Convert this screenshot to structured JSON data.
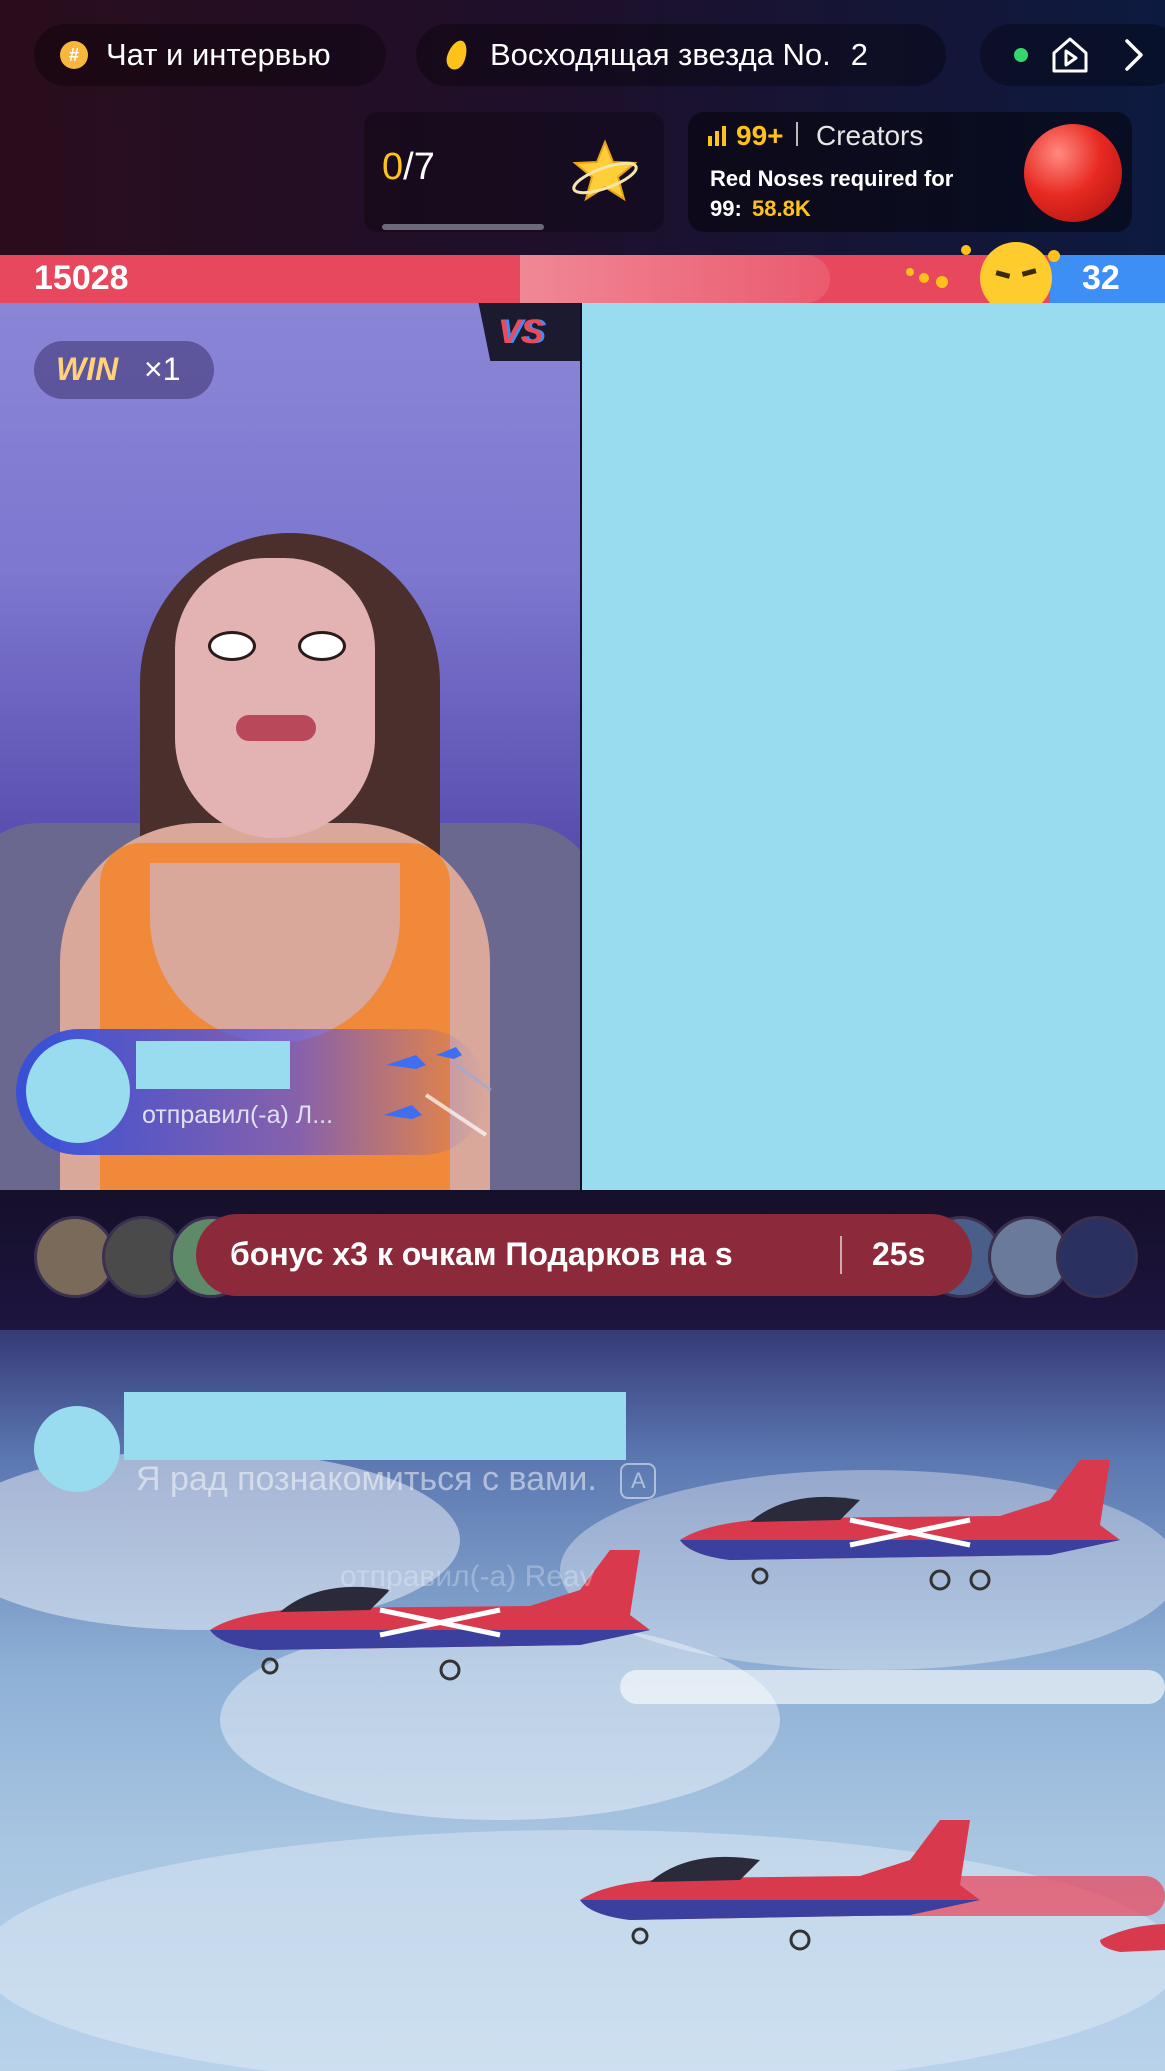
{
  "topbar": {
    "chip1_label": "Чат и интервью",
    "chip2_label": "Восходящая звезда No.",
    "chip2_rank": "2"
  },
  "goal": {
    "progress": "0",
    "total": "/7"
  },
  "creators": {
    "rank": "99+",
    "label": "Creators",
    "line1": "Red Noses required for",
    "line2_prefix": "99:",
    "line2_value": "58.8K"
  },
  "battle": {
    "left_score": "15028",
    "right_score": "32",
    "vs_label": "VS",
    "left_share": 0.84
  },
  "win_badge": {
    "label": "WIN",
    "count": "×1"
  },
  "gift_notice": {
    "text": "отправил(-а) Л..."
  },
  "bonus": {
    "text": "бонус x3 к очкам Подарков на s",
    "timer": "25s"
  },
  "chat": {
    "message": "Я рад познакомиться с вами.",
    "faded_line": "отправил(-а) Reav"
  },
  "colors": {
    "pk_red": "#e8485e",
    "pk_blue": "#3e8ff5",
    "accent_gold": "#ffc21a",
    "redacted": "#9adcef",
    "bonus_bg": "#8c2a3c"
  }
}
